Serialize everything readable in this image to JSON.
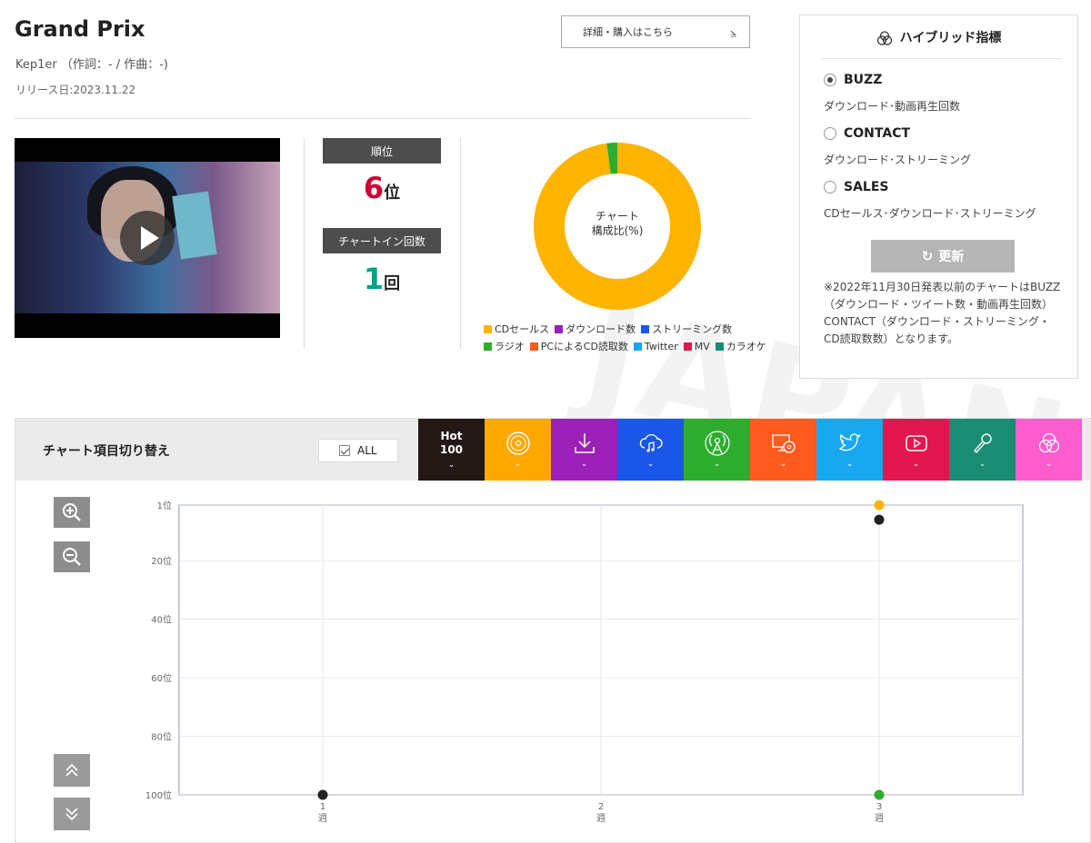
{
  "song": {
    "title": "Grand Prix",
    "artist_credit": "Kep1er （作詞：- / 作曲：-)",
    "release": "リリース日:2023.11.22",
    "detail_button": "詳細・購入はこちら"
  },
  "stats": {
    "rank_label": "順位",
    "rank_value": "6",
    "rank_unit": "位",
    "chartin_label": "チャートイン回数",
    "chartin_value": "1",
    "chartin_unit": "回"
  },
  "donut": {
    "center_line1": "チャート",
    "center_line2": "構成比(%)",
    "segments": [
      {
        "name": "CDセールス",
        "value": 98,
        "color": "#ffb400"
      },
      {
        "name": "ラジオ",
        "value": 2,
        "color": "#2eac2e"
      }
    ],
    "legend_row1": [
      {
        "name": "CDセールス",
        "color": "#ffb400"
      },
      {
        "name": "ダウンロード数",
        "color": "#9b1fb8"
      },
      {
        "name": "ストリーミング数",
        "color": "#1a56e8"
      }
    ],
    "legend_row2": [
      {
        "name": "ラジオ",
        "color": "#2eac2e"
      },
      {
        "name": "PCによるCD読取数",
        "color": "#ff5a1f"
      },
      {
        "name": "Twitter",
        "color": "#19a8f0"
      },
      {
        "name": "MV",
        "color": "#e2164e"
      },
      {
        "name": "カラオケ",
        "color": "#1a8c73"
      }
    ]
  },
  "hybrid": {
    "title": "ハイブリッド指標",
    "options": [
      {
        "label": "BUZZ",
        "desc": "ダウンロード･動画再生回数",
        "selected": true
      },
      {
        "label": "CONTACT",
        "desc": "ダウンロード･ストリーミング",
        "selected": false
      },
      {
        "label": "SALES",
        "desc": "CDセールス･ダウンロード･ストリーミング",
        "selected": false
      }
    ],
    "update_label": "更新",
    "note": "※2022年11月30日発表以前のチャートはBUZZ（ダウンロード・ツイート数・動画再生回数）CONTACT（ダウンロード・ストリーミング・CD読取数数）となります。"
  },
  "chart_panel": {
    "title": "チャート項目切り替え",
    "all_label": "ALL",
    "tabs": [
      {
        "name": "hot100",
        "text1": "Hot",
        "text2": "100",
        "color": "#231815"
      },
      {
        "name": "cd-sales",
        "icon": "cd-icon",
        "color": "#ffa800"
      },
      {
        "name": "download",
        "icon": "download-icon",
        "color": "#9b1fb8"
      },
      {
        "name": "streaming",
        "icon": "streaming-icon",
        "color": "#1a56e8"
      },
      {
        "name": "radio",
        "icon": "radio-icon",
        "color": "#2eac2e"
      },
      {
        "name": "pc-cd-read",
        "icon": "pc-cd-icon",
        "color": "#ff5a1f"
      },
      {
        "name": "twitter",
        "icon": "twitter-icon",
        "color": "#19a8f0"
      },
      {
        "name": "mv",
        "icon": "youtube-icon",
        "color": "#e2164e"
      },
      {
        "name": "karaoke",
        "icon": "microphone-icon",
        "color": "#1a8c73"
      },
      {
        "name": "hybrid",
        "icon": "hybrid-icon",
        "color": "#ff5ccd"
      }
    ]
  },
  "chart_data": {
    "type": "scatter",
    "y_reversed": true,
    "ylim": [
      1,
      100
    ],
    "ytick_labels": [
      "1位",
      "20位",
      "40位",
      "60位",
      "80位",
      "100位"
    ],
    "ytick_values": [
      1,
      20,
      40,
      60,
      80,
      100
    ],
    "x_ticks": [
      {
        "num": "1",
        "unit": "週"
      },
      {
        "num": "2",
        "unit": "週"
      },
      {
        "num": "3",
        "unit": "週"
      }
    ],
    "xlim": [
      1,
      3
    ],
    "series": [
      {
        "color": "#ffb400",
        "points": [
          {
            "x": 3,
            "y": 1
          }
        ]
      },
      {
        "color": "#222222",
        "points": [
          {
            "x": 1,
            "y": 100
          },
          {
            "x": 3,
            "y": 6
          }
        ]
      },
      {
        "color": "#2eac2e",
        "points": [
          {
            "x": 3,
            "y": 100
          }
        ]
      }
    ]
  }
}
